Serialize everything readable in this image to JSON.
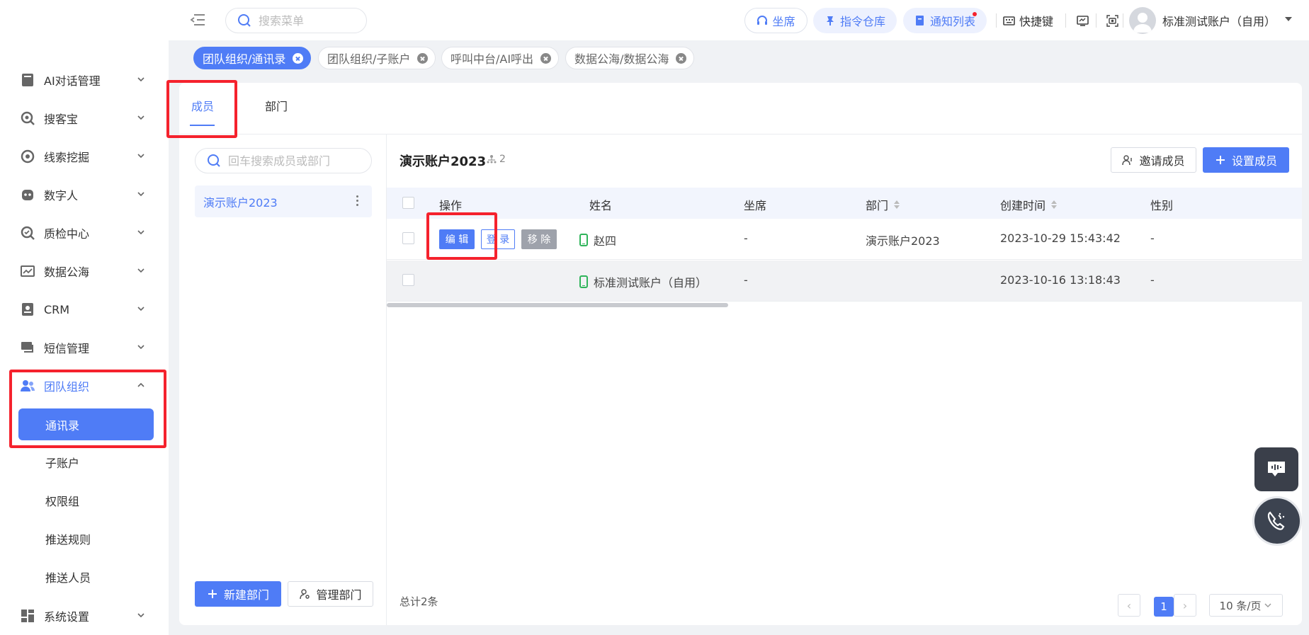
{
  "header": {
    "search_placeholder": "搜索菜单",
    "seat_label": "坐席",
    "command_label": "指令仓库",
    "notify_label": "通知列表",
    "shortcut_label": "快捷键",
    "user_name": "标准测试账户（自用）",
    "accent_color": "#4f7cf6",
    "notify_dot_color": "#f5222d"
  },
  "sidebar": {
    "items": [
      {
        "label": "AI对话管理",
        "icon": "book-icon"
      },
      {
        "label": "搜客宝",
        "icon": "search-magnifier-icon"
      },
      {
        "label": "线索挖掘",
        "icon": "target-icon"
      },
      {
        "label": "数字人",
        "icon": "robot-face-icon"
      },
      {
        "label": "质检中心",
        "icon": "inspect-icon"
      },
      {
        "label": "数据公海",
        "icon": "chart-line-icon"
      },
      {
        "label": "CRM",
        "icon": "contact-card-icon"
      },
      {
        "label": "短信管理",
        "icon": "message-icon"
      },
      {
        "label": "团队组织",
        "icon": "team-icon"
      },
      {
        "label": "系统设置",
        "icon": "grid-settings-icon"
      }
    ],
    "sub_items": [
      "通讯录",
      "子账户",
      "权限组",
      "推送规则",
      "推送人员"
    ]
  },
  "page_tabs": [
    {
      "label": "团队组织/通讯录",
      "active": true
    },
    {
      "label": "团队组织/子账户",
      "active": false
    },
    {
      "label": "呼叫中台/AI呼出",
      "active": false
    },
    {
      "label": "数据公海/数据公海",
      "active": false
    }
  ],
  "main": {
    "tabs": [
      "成员",
      "部门"
    ],
    "dept_search_placeholder": "回车搜索成员或部门",
    "dept_item": "演示账户2023",
    "new_dept_label": "新建部门",
    "manage_dept_label": "管理部门",
    "account_title": "演示账户2023",
    "member_count": "2",
    "invite_label": "邀请成员",
    "set_member_label": "设置成员"
  },
  "table": {
    "columns": [
      "操作",
      "姓名",
      "坐席",
      "部门",
      "创建时间",
      "性别"
    ],
    "actions": {
      "edit": "编 辑",
      "login": "登 录",
      "remove": "移 除"
    },
    "rows": [
      {
        "name": "赵四",
        "seat": "-",
        "dept": "演示账户2023",
        "created": "2023-10-29 15:43:42",
        "gender": "-"
      },
      {
        "name": "标准测试账户（自用）",
        "seat": "-",
        "dept": "",
        "created": "2023-10-16 13:18:43",
        "gender": "-"
      }
    ]
  },
  "pagination": {
    "total": "总计2条",
    "current_page": "1",
    "page_size": "10 条/页"
  }
}
